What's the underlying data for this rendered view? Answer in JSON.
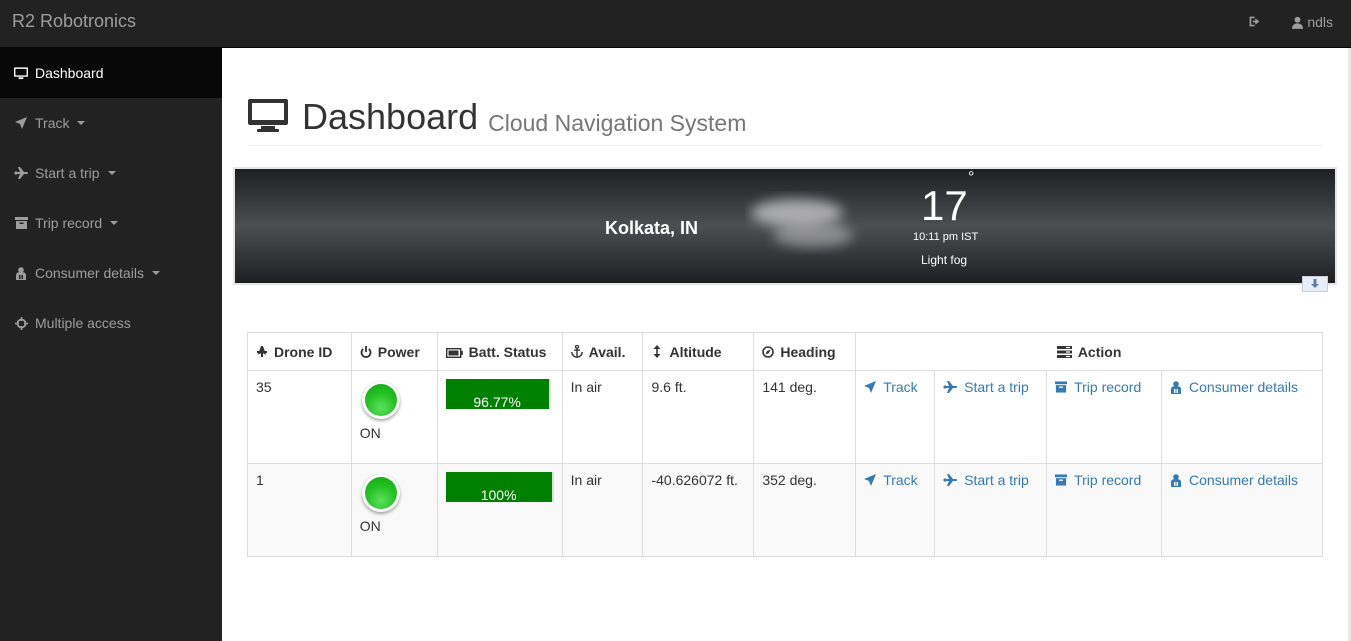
{
  "brand": "R2 Robotronics",
  "user": "ndls",
  "sidebar": [
    {
      "label": "Dashboard",
      "icon": "monitor-icon",
      "active": true
    },
    {
      "label": "Track",
      "icon": "location-arrow-icon",
      "dropdown": true
    },
    {
      "label": "Start a trip",
      "icon": "plane-icon",
      "dropdown": true
    },
    {
      "label": "Trip record",
      "icon": "archive-icon",
      "dropdown": true
    },
    {
      "label": "Consumer details",
      "icon": "user-group-icon",
      "dropdown": true
    },
    {
      "label": "Multiple access",
      "icon": "crosshairs-icon"
    }
  ],
  "page": {
    "title": "Dashboard",
    "subtitle": "Cloud Navigation System"
  },
  "weather": {
    "city": "Kolkata, IN",
    "temp": "17",
    "degree": "°",
    "time": "10:11 pm IST",
    "condition": "Light fog"
  },
  "table": {
    "headers": [
      "Drone ID",
      "Power",
      "Batt. Status",
      "Avail.",
      "Altitude",
      "Heading",
      "Action"
    ],
    "rows": [
      {
        "id": "35",
        "power": "ON",
        "battery": "96.77%",
        "battery_level": 0.9677,
        "avail": "In air",
        "altitude": "9.6 ft.",
        "heading": "141 deg.",
        "actions": [
          "Track",
          "Start a trip",
          "Trip record",
          "Consumer details"
        ]
      },
      {
        "id": "1",
        "power": "ON",
        "battery": "100%",
        "battery_level": 1.0,
        "avail": "In air",
        "altitude": "-40.626072 ft.",
        "heading": "352 deg.",
        "actions": [
          "Track",
          "Start a trip",
          "Trip record",
          "Consumer details"
        ]
      }
    ]
  },
  "colors": {
    "navbar": "#222222",
    "active_bg": "#080808",
    "link": "#337ab7",
    "battery": "#008000",
    "led": "#22c222"
  }
}
